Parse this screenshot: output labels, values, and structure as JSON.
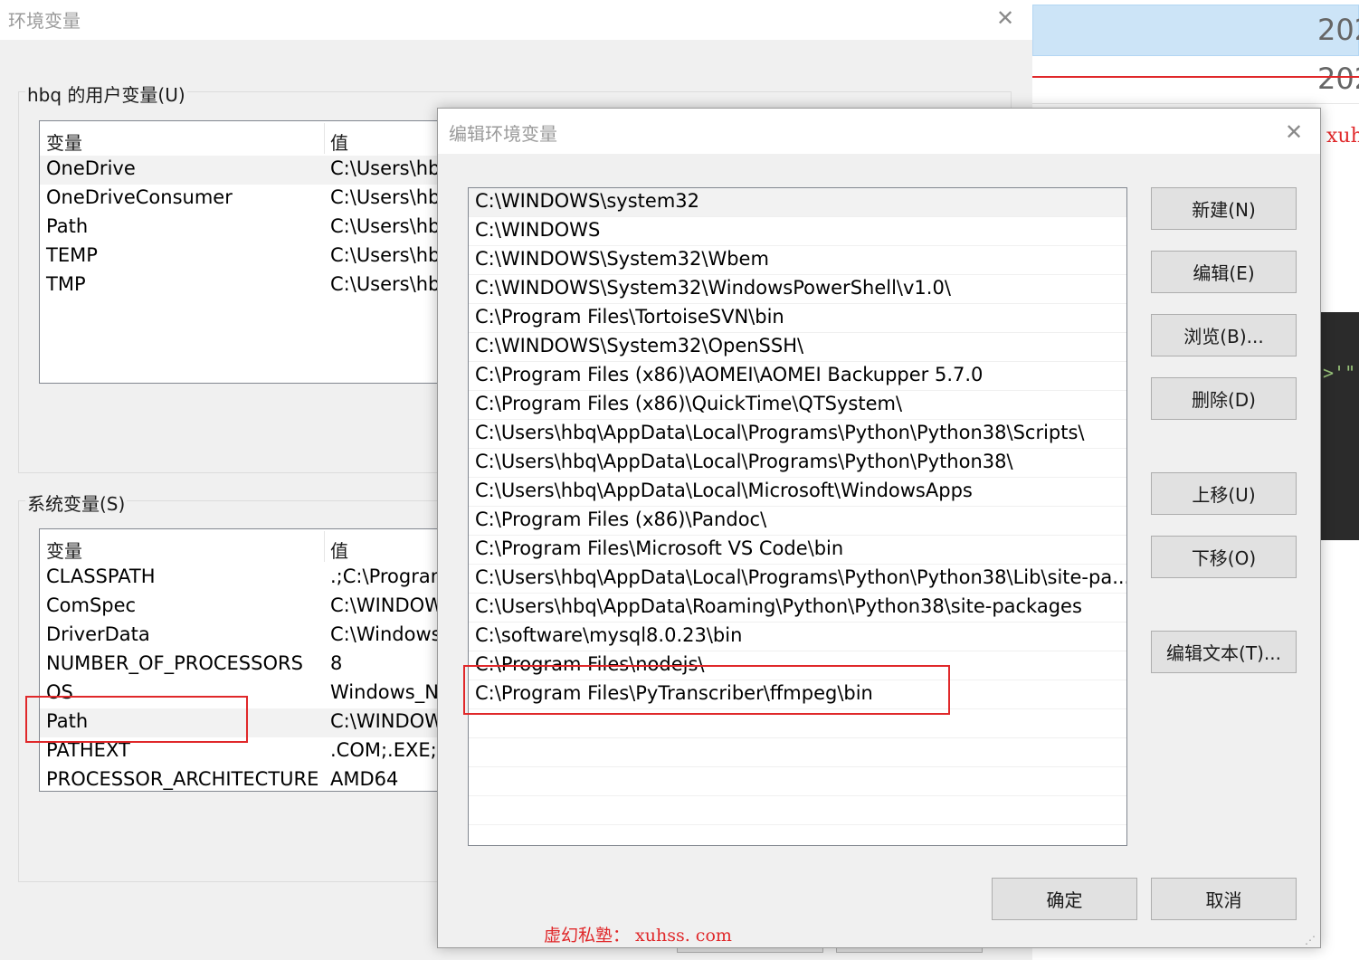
{
  "env_window": {
    "title": "环境变量",
    "close_glyph": "✕",
    "user_vars": {
      "label": "hbq 的用户变量(U)",
      "col_name": "变量",
      "col_value": "值",
      "rows": [
        {
          "name": "OneDrive",
          "value": "C:\\Users\\hb"
        },
        {
          "name": "OneDriveConsumer",
          "value": "C:\\Users\\hb"
        },
        {
          "name": "Path",
          "value": "C:\\Users\\hb"
        },
        {
          "name": "TEMP",
          "value": "C:\\Users\\hb"
        },
        {
          "name": "TMP",
          "value": "C:\\Users\\hb"
        }
      ]
    },
    "system_vars": {
      "label": "系统变量(S)",
      "col_name": "变量",
      "col_value": "值",
      "rows": [
        {
          "name": "CLASSPATH",
          "value": ".;C:\\Program"
        },
        {
          "name": "ComSpec",
          "value": "C:\\WINDOW"
        },
        {
          "name": "DriverData",
          "value": "C:\\Windows"
        },
        {
          "name": "NUMBER_OF_PROCESSORS",
          "value": "8"
        },
        {
          "name": "OS",
          "value": "Windows_N"
        },
        {
          "name": "Path",
          "value": "C:\\WINDOW"
        },
        {
          "name": "PATHEXT",
          "value": ".COM;.EXE;.I"
        },
        {
          "name": "PROCESSOR_ARCHITECTURE",
          "value": "AMD64"
        }
      ]
    }
  },
  "edit_dialog": {
    "title": "编辑环境变量",
    "close_glyph": "✕",
    "paths": [
      "C:\\WINDOWS\\system32",
      "C:\\WINDOWS",
      "C:\\WINDOWS\\System32\\Wbem",
      "C:\\WINDOWS\\System32\\WindowsPowerShell\\v1.0\\",
      "C:\\Program Files\\TortoiseSVN\\bin",
      "C:\\WINDOWS\\System32\\OpenSSH\\",
      "C:\\Program Files (x86)\\AOMEI\\AOMEI Backupper 5.7.0",
      "C:\\Program Files (x86)\\QuickTime\\QTSystem\\",
      "C:\\Users\\hbq\\AppData\\Local\\Programs\\Python\\Python38\\Scripts\\",
      "C:\\Users\\hbq\\AppData\\Local\\Programs\\Python\\Python38\\",
      "C:\\Users\\hbq\\AppData\\Local\\Microsoft\\WindowsApps",
      "C:\\Program Files (x86)\\Pandoc\\",
      "C:\\Program Files\\Microsoft VS Code\\bin",
      "C:\\Users\\hbq\\AppData\\Local\\Programs\\Python\\Python38\\Lib\\site-pa...",
      "C:\\Users\\hbq\\AppData\\Roaming\\Python\\Python38\\site-packages",
      "C:\\software\\mysql8.0.23\\bin",
      "C:\\Program Files\\nodejs\\",
      "C:\\Program Files\\PyTranscriber\\ffmpeg\\bin"
    ],
    "buttons": {
      "new": "新建(N)",
      "edit": "编辑(E)",
      "browse": "浏览(B)...",
      "delete": "删除(D)",
      "move_up": "上移(U)",
      "move_down": "下移(O)",
      "edit_text": "编辑文本(T)...",
      "ok": "确定",
      "cancel": "取消"
    },
    "grip_glyph": "⋰"
  },
  "background": {
    "row1_text": "202",
    "row2_text": "202",
    "red_text": "xuh",
    "code_text": ">'\""
  },
  "watermark": "虚幻私塾： xuhss. com",
  "colors": {
    "highlight_red": "#e0282a",
    "dialog_bg": "#f0f0f0",
    "button_bg": "#e1e1e1"
  }
}
